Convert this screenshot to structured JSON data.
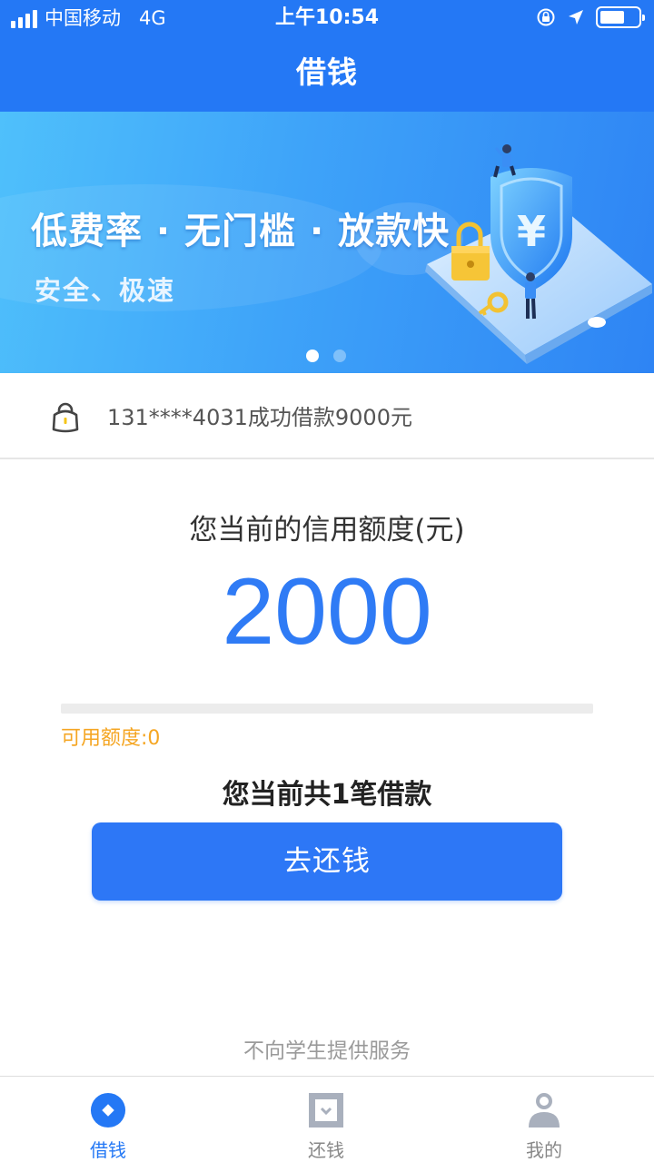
{
  "status_bar": {
    "carrier": "中国移动",
    "network": "4G",
    "time": "上午10:54"
  },
  "header": {
    "title": "借钱"
  },
  "banner": {
    "headline": "低费率 · 无门槛 · 放款快",
    "subline": "安全、极速",
    "slide_count": 2,
    "active_slide": 0,
    "currency_symbol": "¥"
  },
  "notice": {
    "icon": "lock-icon",
    "text": "131****4031成功借款9000元"
  },
  "credit": {
    "label": "您当前的信用额度(元)",
    "amount": "2000",
    "available_text": "可用额度:0",
    "used_fraction": 0,
    "loan_count_text": "您当前共1笔借款"
  },
  "repay_button": {
    "label": "去还钱"
  },
  "footer_note": "不向学生提供服务",
  "tabs": [
    {
      "label": "借钱",
      "icon": "borrow-icon",
      "active": true
    },
    {
      "label": "还钱",
      "icon": "repay-icon",
      "active": false
    },
    {
      "label": "我的",
      "icon": "profile-icon",
      "active": false
    }
  ],
  "colors": {
    "primary": "#2478f5",
    "button": "#2d77f6",
    "amount": "#2f7bf5",
    "available": "#f5a623",
    "muted": "#9a9a9a"
  }
}
